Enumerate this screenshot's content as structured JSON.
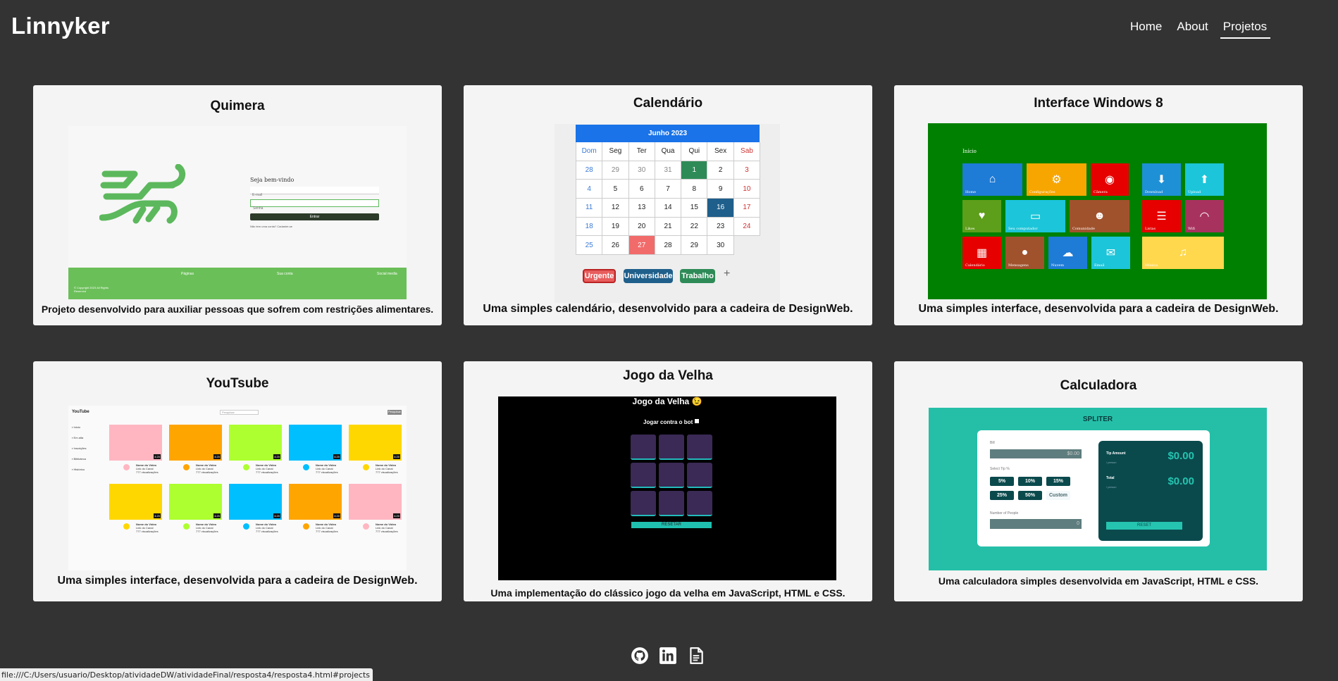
{
  "brand": "Linnyker",
  "nav": [
    "Home",
    "About",
    "Projetos"
  ],
  "projects": [
    {
      "title": "Quimera",
      "description": "Projeto desenvolvido para auxiliar pessoas que sofrem com restrições alimentares.",
      "preview": {
        "welcome": "Seja bem-vindo",
        "email_placeholder": "E-mail",
        "password_placeholder": "Senha",
        "button": "Entrar",
        "signup": "Não tem uma conta? Cadastre-se",
        "footer_cols": [
          "Páginas",
          "Sua conta",
          "Social media"
        ],
        "copyright": "© Copyright 2023 All Rights Reserved"
      }
    },
    {
      "title": "Calendário",
      "description": "Uma simples calendário, desenvolvido para a cadeira de DesignWeb.",
      "preview": {
        "month": "Junho 2023",
        "weekdays": [
          "Dom",
          "Seg",
          "Ter",
          "Qua",
          "Qui",
          "Sex",
          "Sab"
        ],
        "days": [
          "28",
          "29",
          "30",
          "31",
          "1",
          "2",
          "3",
          "4",
          "5",
          "6",
          "7",
          "8",
          "9",
          "10",
          "11",
          "12",
          "13",
          "14",
          "15",
          "16",
          "17",
          "18",
          "19",
          "20",
          "21",
          "22",
          "23",
          "24",
          "25",
          "26",
          "27",
          "28",
          "29",
          "30",
          ""
        ],
        "tags": [
          "Urgente",
          "Universidade",
          "Trabalho"
        ],
        "add": "+"
      }
    },
    {
      "title": "Interface Windows 8",
      "description": "Uma simples interface, desenvolvida para a cadeira de DesignWeb.",
      "preview": {
        "heading": "Início",
        "tiles": [
          "Home",
          "Configurações",
          "Câmera",
          "Download",
          "Upload",
          "Likes",
          "Seu computador",
          "Comunidade",
          "Listas",
          "Wifi",
          "Calendário",
          "Mensagens",
          "Nuvem",
          "Email",
          "Música"
        ]
      }
    },
    {
      "title": "YouTsube",
      "description": "Uma simples interface, desenvolvida para a cadeira de DesignWeb.",
      "preview": {
        "logo": "YouTube",
        "search_placeholder": "Pesquisar",
        "search_button": "Pesquisar",
        "sidebar": [
          "Inicio",
          "Em alta",
          "Inscrições",
          "Biblioteca",
          "Histórico"
        ],
        "video_title": "Nome do Vídeo",
        "channel": "Link do Canal",
        "views": "777 visualizações",
        "duration": "4:20"
      }
    },
    {
      "title": "Jogo da Velha",
      "description": "Uma implementação do clássico jogo da velha em JavaScript, HTML e CSS.",
      "preview": {
        "heading": "Jogo da Velha 😉",
        "bot_label": "Jogar contra o bot",
        "reset": "RESETAR"
      }
    },
    {
      "title": "Calculadora",
      "description": "Uma calculadora simples desenvolvida em JavaScript, HTML e CSS.",
      "preview": {
        "heading": "SPLITER",
        "bill_label": "Bill",
        "bill_placeholder": "$0.00",
        "tip_label": "Select Tip %",
        "tips": [
          "5%",
          "10%",
          "15%",
          "25%",
          "50%",
          "Custom"
        ],
        "people_label": "Number of People",
        "people_placeholder": "0",
        "tip_amount_label": "Tip Amount",
        "total_label": "Total",
        "per_person": "/ person",
        "tip_amount": "$0.00",
        "total": "$0.00",
        "reset": "RESET"
      }
    }
  ],
  "social": [
    "github-icon",
    "linkedin-icon",
    "document-icon"
  ],
  "status_url": "file:///C:/Users/usuario/Desktop/atividadeDW/atividadeFinal/resposta4/resposta4.html#projects"
}
